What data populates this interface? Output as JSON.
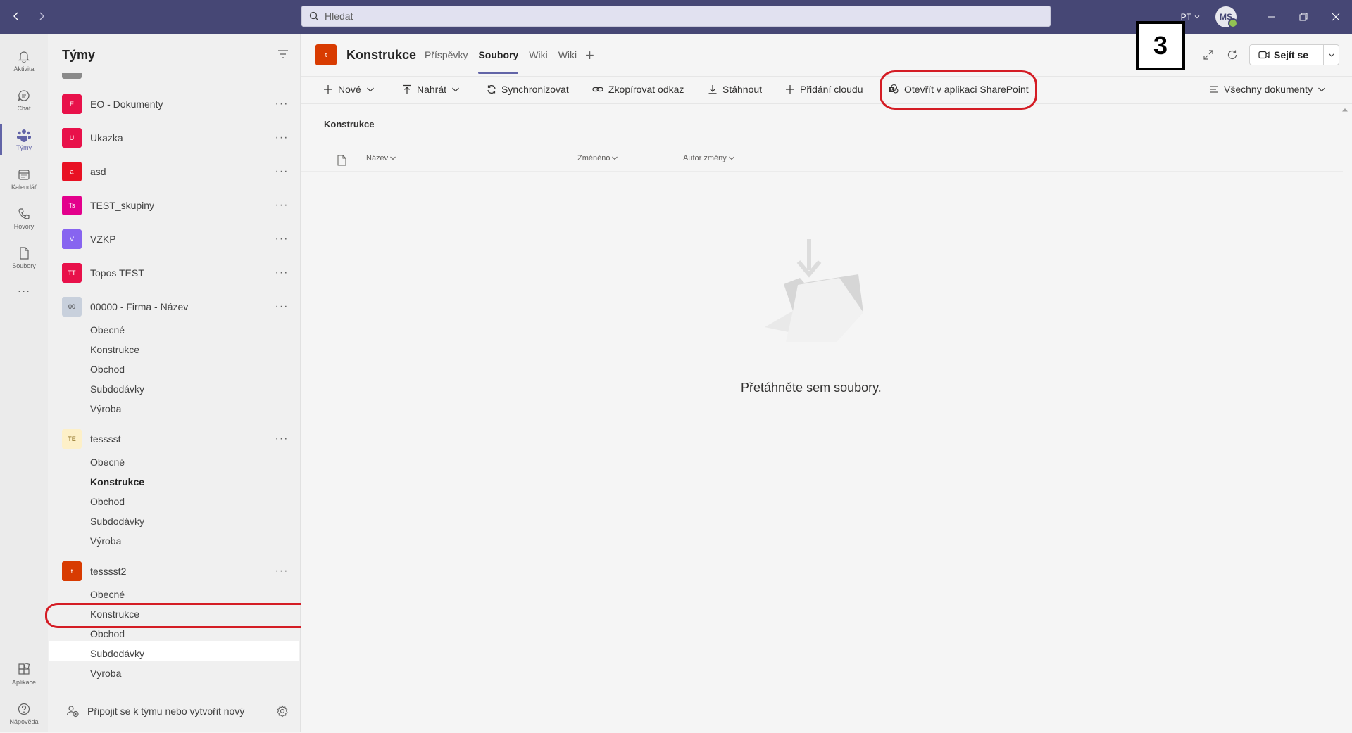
{
  "titlebar": {
    "search_placeholder": "Hledat",
    "org_label": "PT",
    "avatar_initials": "MS"
  },
  "rail": {
    "items": [
      {
        "label": "Aktivita",
        "icon": "bell-icon"
      },
      {
        "label": "Chat",
        "icon": "chat-icon"
      },
      {
        "label": "Týmy",
        "icon": "teams-icon",
        "active": true
      },
      {
        "label": "Kalendář",
        "icon": "calendar-icon"
      },
      {
        "label": "Hovory",
        "icon": "phone-icon"
      },
      {
        "label": "Soubory",
        "icon": "file-icon"
      }
    ],
    "more": "...",
    "bottom": [
      {
        "label": "Aplikace",
        "icon": "apps-icon"
      },
      {
        "label": "Nápověda",
        "icon": "help-icon"
      }
    ]
  },
  "teams_panel": {
    "title": "Týmy",
    "teams": [
      {
        "initials": "E",
        "name": "EO - Dokumenty",
        "color": "#e8114a"
      },
      {
        "initials": "U",
        "name": "Ukazka",
        "color": "#e8114a"
      },
      {
        "initials": "a",
        "name": "asd",
        "color": "#e81123"
      },
      {
        "initials": "Ts",
        "name": "TEST_skupiny",
        "color": "#e3008c"
      },
      {
        "initials": "V",
        "name": "VZKP",
        "color": "#8764f0"
      },
      {
        "initials": "TT",
        "name": "Topos TEST",
        "color": "#e8114a"
      },
      {
        "initials": "00",
        "name": "00000 - Firma - Název",
        "color": "#c8d0dc",
        "channels": [
          "Obecné",
          "Konstrukce",
          "Obchod",
          "Subdodávky",
          "Výroba"
        ]
      },
      {
        "initials": "TE",
        "name": "tesssst",
        "color": "#fdf0c8",
        "channels": [
          "Obecné",
          "Konstrukce",
          "Obchod",
          "Subdodávky",
          "Výroba"
        ]
      },
      {
        "initials": "t",
        "name": "tesssst2",
        "color": "#d83b01",
        "channels": [
          "Obecné",
          "Konstrukce",
          "Obchod",
          "Subdodávky",
          "Výroba"
        ]
      }
    ],
    "more": "···",
    "join_label": "Připojit se k týmu nebo vytvořit nový"
  },
  "channel_header": {
    "tile_initial": "t",
    "title": "Konstrukce",
    "tabs": [
      "Příspěvky",
      "Soubory",
      "Wiki",
      "Wiki"
    ],
    "active_tab": "Soubory",
    "add_tab": "+",
    "step_number": "3",
    "meet_label": "Sejít se"
  },
  "command_bar": {
    "new": "Nové",
    "upload": "Nahrát",
    "sync": "Synchronizovat",
    "copy_link": "Zkopírovat odkaz",
    "download": "Stáhnout",
    "add_cloud": "Přidání cloudu",
    "open_sharepoint": "Otevřít v aplikaci SharePoint",
    "view": "Všechny dokumenty"
  },
  "files": {
    "breadcrumb": "Konstrukce",
    "columns": [
      "Název",
      "Změněno",
      "Autor změny"
    ],
    "empty_message": "Přetáhněte sem soubory."
  }
}
